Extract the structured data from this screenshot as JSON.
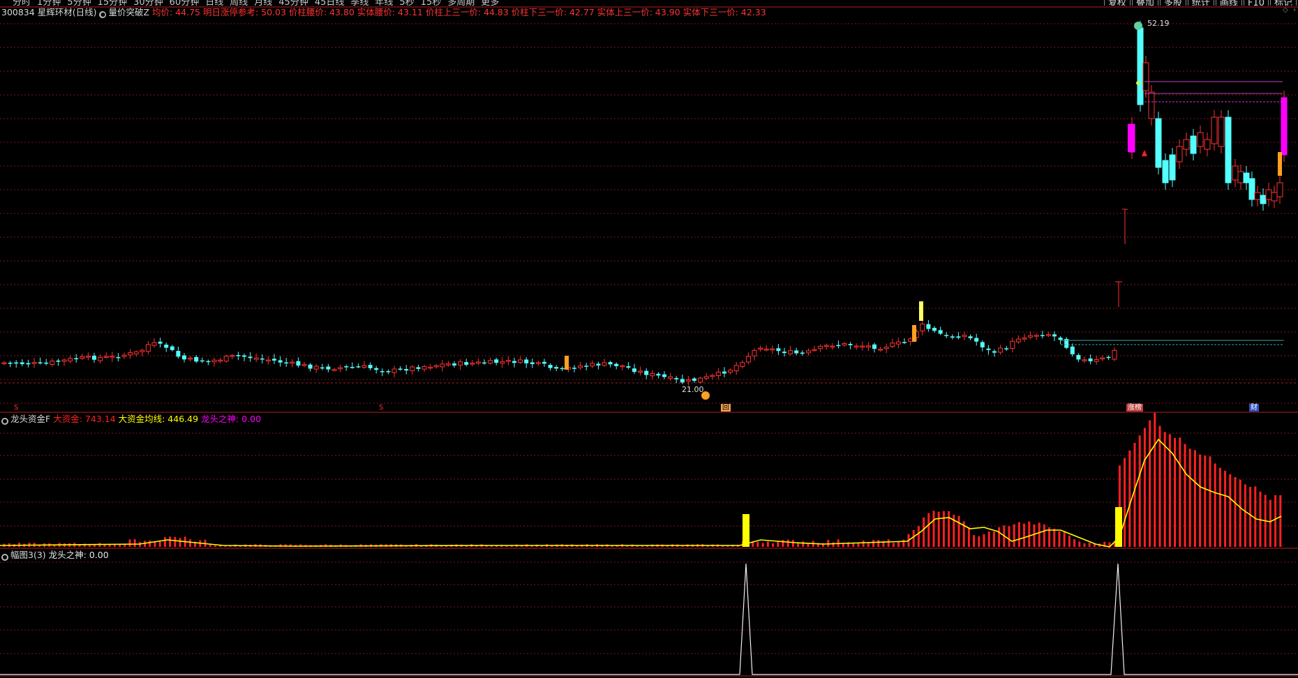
{
  "toolbar": {
    "periods": [
      "分时",
      "1分钟",
      "5分钟",
      "15分钟",
      "30分钟",
      "60分钟",
      "日线",
      "周线",
      "月线",
      "45分钟",
      "45日线",
      "季线",
      "年线",
      "5秒",
      "15秒",
      "多周期",
      "更多"
    ],
    "tools": [
      "复权",
      "叠加",
      "多股",
      "统计",
      "画线",
      "F10",
      "标记"
    ]
  },
  "header": {
    "stock_code": "300834",
    "stock_name": "星辉环材(日线)",
    "indicator": "量价突破Z",
    "values": [
      {
        "label": "均价",
        "value": "44.75"
      },
      {
        "label": "明日涨停参考",
        "value": "50.03"
      },
      {
        "label": "价柱腰价",
        "value": "43.80"
      },
      {
        "label": "实体腰价",
        "value": "43.11"
      },
      {
        "label": "价柱上三一价",
        "value": "44.83"
      },
      {
        "label": "价柱下三一价",
        "value": "42.77"
      },
      {
        "label": "实体上三一价",
        "value": "43.90"
      },
      {
        "label": "实体下三一价",
        "value": "42.33"
      }
    ]
  },
  "main_chart": {
    "high_label": "52.19",
    "low_label": "21.00",
    "markers": [
      "S",
      "S",
      "回",
      "涨榜",
      "财"
    ]
  },
  "fund_panel": {
    "name": "龙头资金F",
    "items": [
      {
        "label": "大资金",
        "value": "743.14",
        "color": "#ff2020"
      },
      {
        "label": "大资金均线",
        "value": "446.49",
        "color": "#ffff00"
      },
      {
        "label": "龙头之神",
        "value": "0.00",
        "color": "#ff00ff"
      }
    ]
  },
  "god_panel": {
    "name": "幅图3(3)",
    "label": "龙头之神",
    "value": "0.00"
  },
  "colors": {
    "up": "#ff3232",
    "down": "#54ffff",
    "grid": "#7a1a1a",
    "ma": "#ffff00",
    "magenta": "#ff00ff"
  }
}
